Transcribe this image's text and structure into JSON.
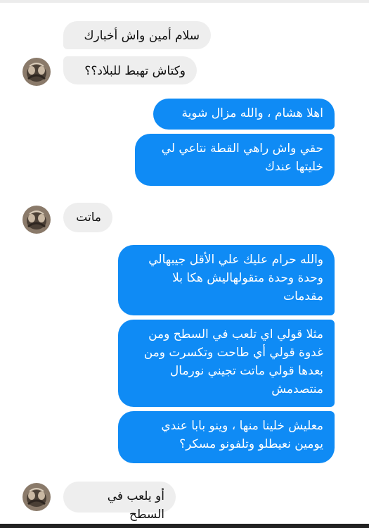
{
  "conversation": {
    "messages": [
      {
        "direction": "incoming",
        "text": "سلام أمين واش أخبارك"
      },
      {
        "direction": "incoming",
        "text": "وكتاش تهبط للبلاد؟؟"
      },
      {
        "direction": "outgoing",
        "text": "اهلا هشام ، والله مزال شوية"
      },
      {
        "direction": "outgoing",
        "text": "حقي واش راهي القطة نتاعي لي خليتها عندك"
      },
      {
        "direction": "incoming",
        "text": "ماتت"
      },
      {
        "direction": "outgoing",
        "text": "والله حرام عليك علي الأقل جيبهالي وحدة وحدة متقولهاليش هكا بلا مقدمات"
      },
      {
        "direction": "outgoing",
        "text": "مثلا قولي اي تلعب في السطح ومن غدوة قولي أي طاحت وتكسرت ومن بعدها قولي ماتت تجيني نورمال منتصدمش"
      },
      {
        "direction": "outgoing",
        "text": "معليش خلينا منها ، وينو بابا عندي يومين نعيطلو وتلفونو مسكر؟"
      },
      {
        "direction": "incoming",
        "text": "أو يلعب في السطح"
      }
    ]
  },
  "colors": {
    "outgoing_bubble": "#0f8bf5",
    "incoming_bubble": "#eeeeee"
  },
  "icons": {
    "avatar": "cat-avatar-icon"
  }
}
